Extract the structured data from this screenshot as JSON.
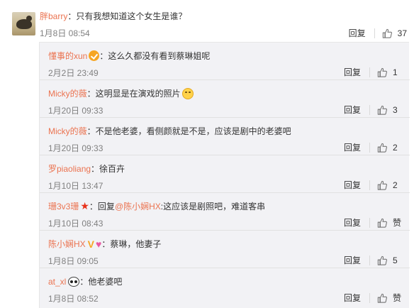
{
  "main": {
    "username": "胖barry",
    "text": "：只有我想知道这个女生是谁？",
    "time": "1月8日 08:54",
    "reply_label": "回复",
    "like_count": "37"
  },
  "replies": [
    {
      "username": "懂事的xun",
      "badge": "vip",
      "text": "：这么久都没有看到蔡琳姐呢",
      "time": "2月2日 23:49",
      "reply_label": "回复",
      "like_count": "1"
    },
    {
      "username": "Micky的薇",
      "badge": "",
      "text": "：这明显是在演戏的照片",
      "emoji": "smile",
      "time": "1月20日 09:33",
      "reply_label": "回复",
      "like_count": "3"
    },
    {
      "username": "Micky的薇",
      "badge": "",
      "text": "：不是他老婆，看侧颜就是不是，应该是剧中的老婆吧",
      "time": "1月20日 09:33",
      "reply_label": "回复",
      "like_count": "2"
    },
    {
      "username": "罗piaoliang",
      "badge": "",
      "text": "：徐百卉",
      "time": "1月10日 13:47",
      "reply_label": "回复",
      "like_count": "2"
    },
    {
      "username": "珊3v3珊",
      "badge": "star",
      "text_prefix": "：回复",
      "reply_to": "@陈小娴HX",
      "text": ":这应该是剧照吧，难道客串",
      "time": "1月10日 08:43",
      "reply_label": "回复",
      "like_count": "赞"
    },
    {
      "username": "陈小娴HX",
      "badge": "v-heart",
      "text": "：蔡琳，他妻子",
      "time": "1月8日 09:05",
      "reply_label": "回复",
      "like_count": "5"
    },
    {
      "username": "at_xl",
      "badge": "panda",
      "text": "：他老婆吧",
      "time": "1月8日 08:52",
      "reply_label": "回复",
      "like_count": "赞"
    }
  ],
  "colors": {
    "username": "#eb7350",
    "time": "#808080",
    "reply_bg": "#f2f2f5"
  },
  "icons": {
    "like": "thumbs-up-icon"
  }
}
